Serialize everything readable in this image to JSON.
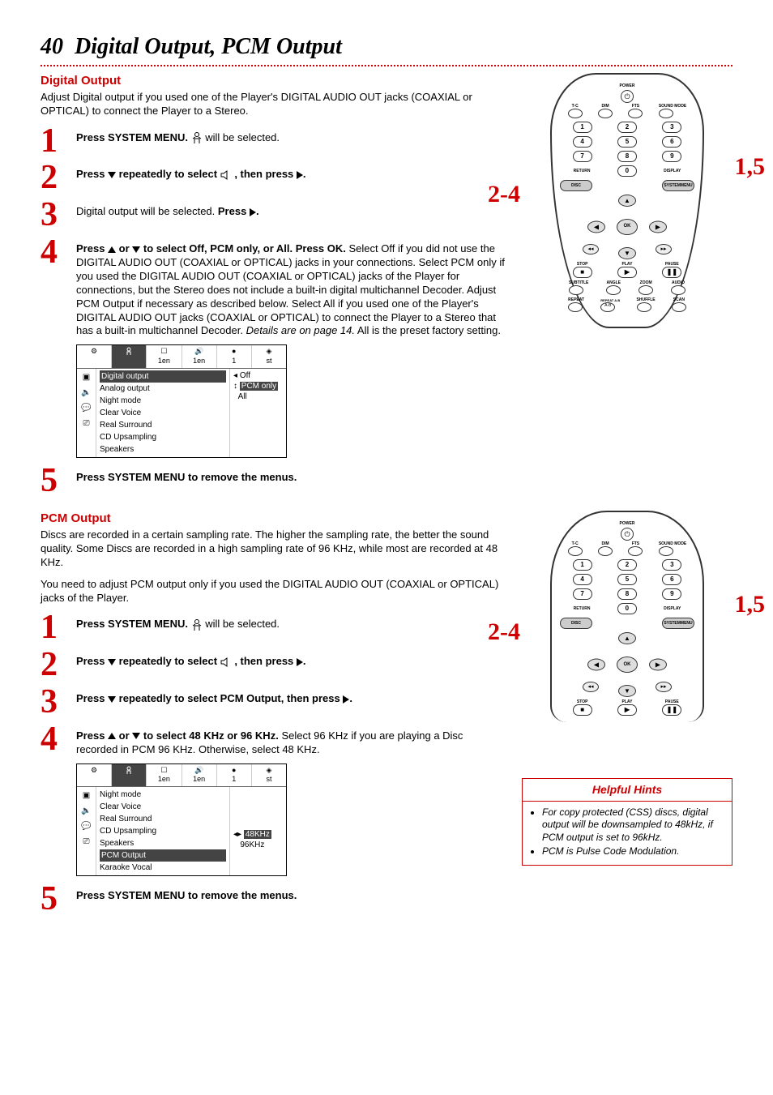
{
  "page": {
    "number": "40",
    "title": "Digital Output, PCM Output"
  },
  "digital": {
    "heading": "Digital Output",
    "intro": "Adjust Digital output if you used one of the Player's DIGITAL AUDIO OUT jacks (COAXIAL or OPTICAL) to connect the Player to a Stereo.",
    "step1_a": "Press SYSTEM MENU.",
    "step1_b": "will be selected.",
    "step2_a": "Press",
    "step2_b": "repeatedly to select",
    "step2_c": ", then press",
    "step2_d": ".",
    "step3_a": "Digital output will be selected.",
    "step3_b": "Press",
    "step3_c": ".",
    "step4_a": "Press",
    "step4_b": "or",
    "step4_c": "to select Off, PCM only, or All. Press OK.",
    "step4_body": "Select Off if you did not use the DIGITAL AUDIO OUT (COAXIAL or OPTICAL) jacks in your connections. Select PCM only if you used the DIGITAL AUDIO OUT (COAXIAL or OPTICAL) jacks of the Player for connections, but the Stereo does not include a built-in digital multichannel Decoder. Adjust PCM Output if necessary as described below. Select All if you used one of the Player's DIGITAL AUDIO OUT jacks (COAXIAL or OPTICAL) to connect the Player to a Stereo that has a built-in multichannel Decoder.",
    "step4_italic": "Details are on page 14.",
    "step4_tail": "All is the preset factory setting.",
    "step5": "Press SYSTEM MENU to remove the menus.",
    "menu": {
      "top": [
        "",
        "1en",
        "1en",
        "1",
        "st"
      ],
      "items": [
        "Digital output",
        "Analog output",
        "Night mode",
        "Clear Voice",
        "Real Surround",
        "CD Upsampling",
        "Speakers"
      ],
      "values": [
        "Off",
        "PCM only",
        "All"
      ]
    }
  },
  "pcm": {
    "heading": "PCM Output",
    "intro1": "Discs are recorded in a certain sampling rate. The higher the sampling rate, the better the sound quality. Some Discs are recorded in a high sampling rate of 96 KHz, while most are recorded at 48 KHz.",
    "intro2": "You need to adjust PCM output only if you used the DIGITAL AUDIO OUT (COAXIAL or OPTICAL) jacks of the Player.",
    "step1_a": "Press SYSTEM MENU.",
    "step1_b": "will be selected.",
    "step2_a": "Press",
    "step2_b": "repeatedly to select",
    "step2_c": ", then press",
    "step2_d": ".",
    "step3_a": "Press",
    "step3_b": "repeatedly to select PCM Output, then press",
    "step3_c": ".",
    "step4_a": "Press",
    "step4_b": "or",
    "step4_c": "to select 48 KHz or 96 KHz.",
    "step4_body": "Select 96 KHz if you are playing a Disc recorded in PCM 96 KHz. Otherwise, select 48 KHz.",
    "step5": "Press SYSTEM MENU to remove the menus.",
    "menu": {
      "top": [
        "",
        "1en",
        "1en",
        "1",
        "st"
      ],
      "items": [
        "Night mode",
        "Clear Voice",
        "Real Surround",
        "CD Upsampling",
        "Speakers",
        "PCM Output",
        "Karaoke Vocal"
      ],
      "values": [
        "48KHz",
        "96KHz"
      ]
    }
  },
  "remote": {
    "power": "POWER",
    "row1": [
      "T-C",
      "DIM",
      "FTS",
      "SOUND MODE"
    ],
    "nums": [
      "1",
      "2",
      "3",
      "4",
      "5",
      "6",
      "7",
      "8",
      "9",
      "0"
    ],
    "return": "RETURN",
    "display": "DISPLAY",
    "disc": "DISC",
    "system": "SYSTEM",
    "menu": "MENU",
    "ok": "OK",
    "transport": [
      "STOP",
      "PLAY",
      "PAUSE"
    ],
    "row_a": [
      "SUBTITLE",
      "ANGLE",
      "ZOOM",
      "AUDIO"
    ],
    "row_b": [
      "REPEAT",
      "REPEAT A-B",
      "SHUFFLE",
      "SCAN"
    ]
  },
  "callouts": {
    "left": "2-4",
    "right": "1,5"
  },
  "hints": {
    "title": "Helpful Hints",
    "items": [
      "For copy protected (CSS) discs, digital output will be downsampled to 48kHz, if PCM output is set to 96kHz.",
      "PCM is Pulse Code Modulation."
    ]
  }
}
